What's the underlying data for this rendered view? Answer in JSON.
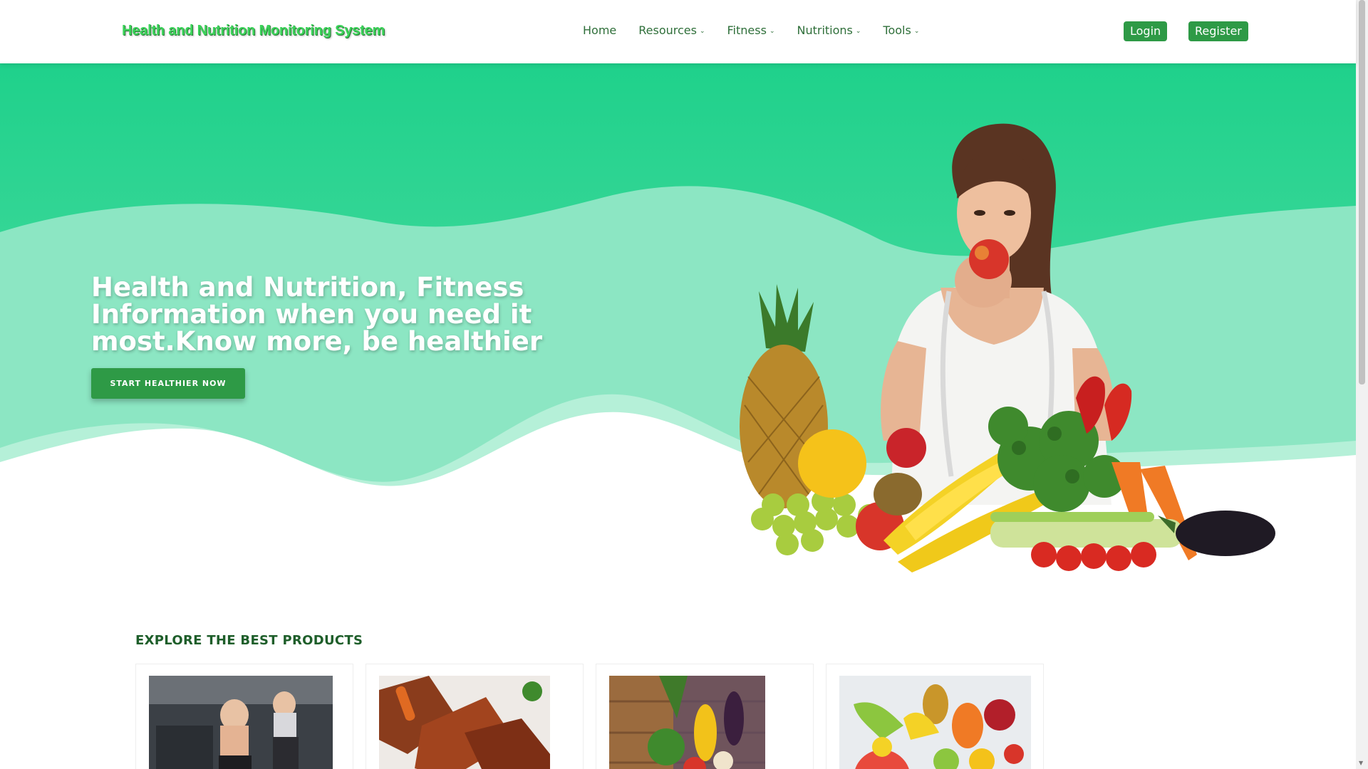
{
  "header": {
    "brand": "Health and Nutrition Monitoring System",
    "nav": [
      {
        "label": "Home",
        "dropdown": false
      },
      {
        "label": "Resources",
        "dropdown": true
      },
      {
        "label": "Fitness",
        "dropdown": true
      },
      {
        "label": "Nutritions",
        "dropdown": true
      },
      {
        "label": "Tools",
        "dropdown": true
      }
    ],
    "login_label": "Login",
    "register_label": "Register"
  },
  "hero": {
    "title": "Health and Nutrition, Fitness Information when you need it most.Know more, be healthier",
    "cta_label": "START HEALTHIER NOW"
  },
  "products": {
    "title": "EXPLORE THE BEST PRODUCTS",
    "cards": [
      {
        "image": "treadmill-workout-photo"
      },
      {
        "image": "glazed-meat-dish-photo"
      },
      {
        "image": "vegetables-on-wood-photo"
      },
      {
        "image": "assorted-fruits-photo"
      }
    ]
  },
  "colors": {
    "brand_green": "#2e9a46",
    "hero_top": "#1fd18b",
    "hero_mid": "#8ce6c3",
    "hero_low": "#b5f0d8",
    "title_green": "#1e5e2a"
  }
}
